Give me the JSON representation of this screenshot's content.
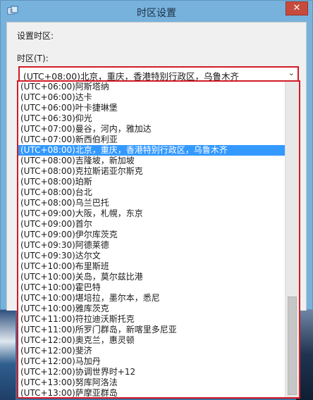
{
  "window": {
    "title": "时区设置",
    "close_symbol": "✕"
  },
  "dialog": {
    "prompt": "设置时区:",
    "timezone_label": "时区(T):",
    "selected_value": "(UTC+08:00)北京，重庆，香港特别行政区，乌鲁木齐",
    "dropdown_arrow": "⌄"
  },
  "timezones": [
    "(UTC+06:00)阿斯塔纳",
    "(UTC+06:00)达卡",
    "(UTC+06:00)叶卡捷琳堡",
    "(UTC+06:30)仰光",
    "(UTC+07:00)曼谷，河内，雅加达",
    "(UTC+07:00)新西伯利亚",
    "(UTC+08:00)北京，重庆，香港特别行政区，乌鲁木齐",
    "(UTC+08:00)吉隆坡，新加坡",
    "(UTC+08:00)克拉斯诺亚尔斯克",
    "(UTC+08:00)珀斯",
    "(UTC+08:00)台北",
    "(UTC+08:00)乌兰巴托",
    "(UTC+09:00)大阪，札幌，东京",
    "(UTC+09:00)首尔",
    "(UTC+09:00)伊尔库茨克",
    "(UTC+09:30)阿德莱德",
    "(UTC+09:30)达尔文",
    "(UTC+10:00)布里斯班",
    "(UTC+10:00)关岛，莫尔兹比港",
    "(UTC+10:00)霍巴特",
    "(UTC+10:00)堪培拉，墨尔本，悉尼",
    "(UTC+10:00)雅库茨克",
    "(UTC+11:00)符拉迪沃斯托克",
    "(UTC+11:00)所罗门群岛，新喀里多尼亚",
    "(UTC+12:00)奥克兰，惠灵顿",
    "(UTC+12:00)斐济",
    "(UTC+12:00)马加丹",
    "(UTC+12:00)协调世界时+12",
    "(UTC+13:00)努库阿洛法",
    "(UTC+13:00)萨摩亚群岛"
  ],
  "selected_index": 6
}
